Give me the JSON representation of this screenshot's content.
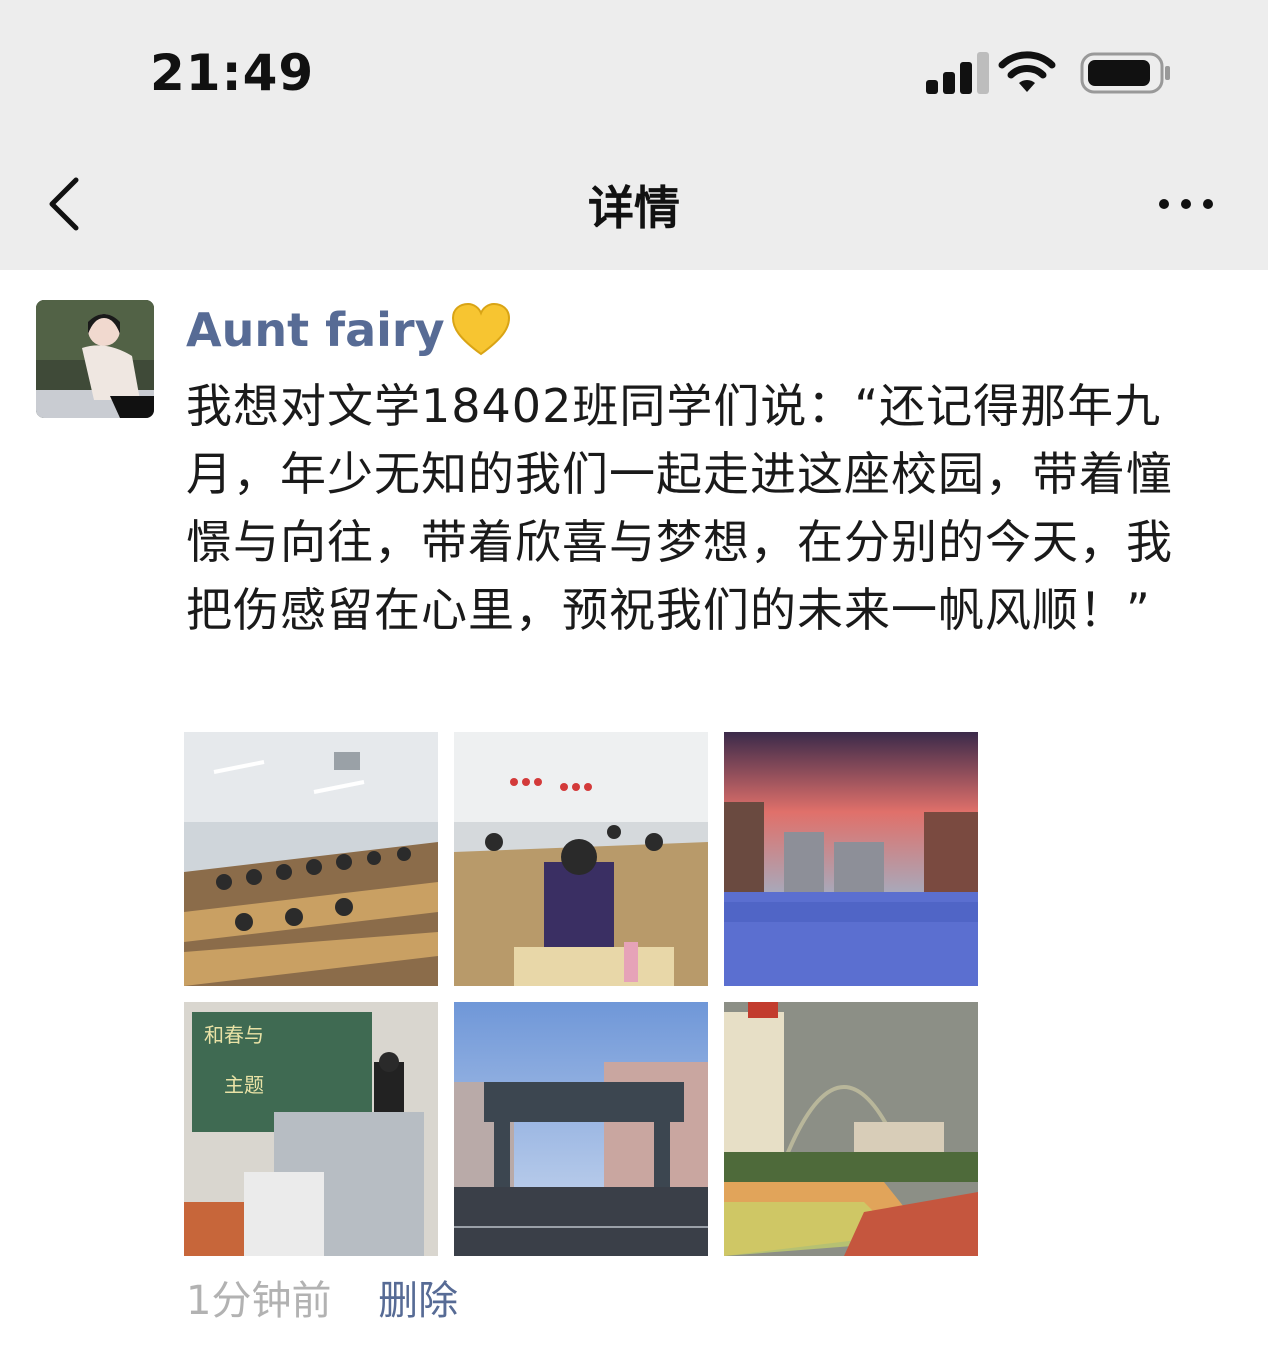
{
  "status_bar": {
    "time": "21:49",
    "signal_icon": "cellular-signal-icon",
    "wifi_icon": "wifi-icon",
    "battery_icon": "battery-icon"
  },
  "nav": {
    "title": "详情",
    "back_icon": "chevron-left-icon",
    "more_icon": "more-dots-icon"
  },
  "post": {
    "author": "Aunt fairy",
    "author_emoji_icon": "yellow-heart-icon",
    "text": "我想对文学18402班同学们说：“还记得那年九月，年少无知的我们一起走进这座校园，带着憧憬与向往，带着欣喜与梦想，在分别的今天，我把伤感留在心里，预祝我们的未来一帆风顺！”",
    "photos": [
      {
        "subject": "lecture-hall-students-photo"
      },
      {
        "subject": "classroom-students-reading-photo"
      },
      {
        "subject": "campus-sunset-photo"
      },
      {
        "subject": "speech-at-podium-photo"
      },
      {
        "subject": "college-gate-photo"
      },
      {
        "subject": "stadium-rainbow-photo"
      }
    ],
    "time_ago": "1分钟前",
    "delete_label": "删除"
  },
  "colors": {
    "link": "#576b95",
    "meta_gray": "#b2b2b2",
    "header_bg": "#ededed"
  }
}
